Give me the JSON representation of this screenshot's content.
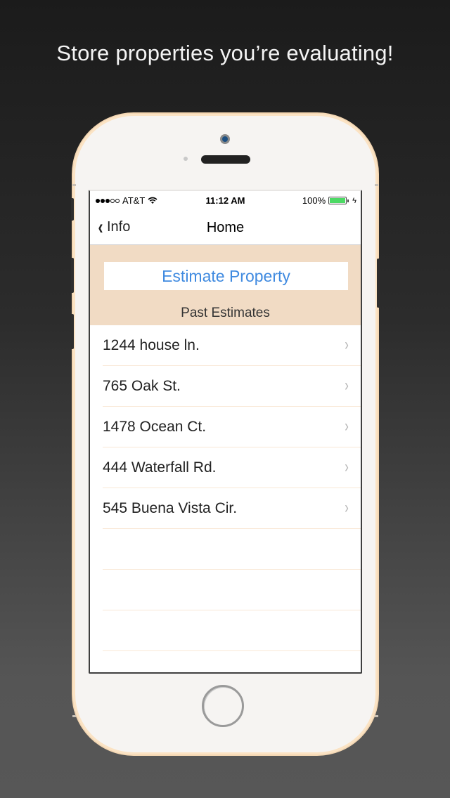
{
  "headline": "Store properties you’re evaluating!",
  "status_bar": {
    "carrier": "AT&T",
    "signal_bars_filled": 3,
    "signal_bars_total": 5,
    "time": "11:12 AM",
    "battery_percent_label": "100%",
    "battery_level": 1.0,
    "charging_icon": "ϟ"
  },
  "nav": {
    "back_label": "Info",
    "back_icon": "‹",
    "title": "Home"
  },
  "actions": {
    "estimate_label": "Estimate Property"
  },
  "section": {
    "title": "Past Estimates"
  },
  "estimates": [
    {
      "address": "1244 house ln.",
      "chevron": "›"
    },
    {
      "address": "765 Oak St.",
      "chevron": "›"
    },
    {
      "address": "1478 Ocean Ct.",
      "chevron": "›"
    },
    {
      "address": "444 Waterfall Rd.",
      "chevron": "›"
    },
    {
      "address": "545 Buena Vista Cir.",
      "chevron": "›"
    }
  ],
  "colors": {
    "accent": "#3f8ae0",
    "header_bg": "#f1dbc4",
    "battery": "#4cd964",
    "phone_trim": "#fbe3c4"
  }
}
